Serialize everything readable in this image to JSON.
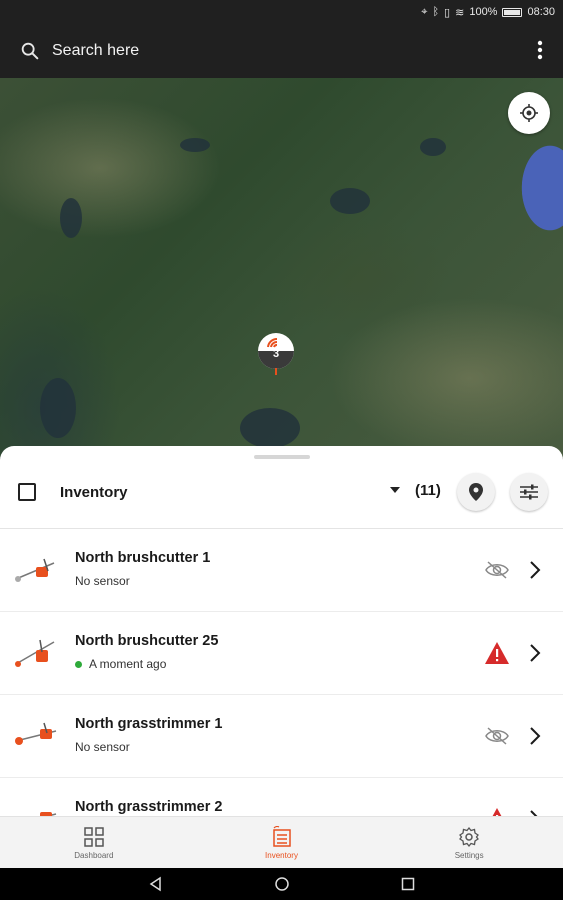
{
  "status_bar": {
    "battery": "100%",
    "time": "08:30",
    "icons": [
      "location-icon",
      "bluetooth-icon",
      "vibrate-icon",
      "wifi-icon",
      "battery-icon"
    ]
  },
  "app_bar": {
    "search_placeholder": "Search here",
    "icons": [
      "search-icon",
      "more-vert-icon"
    ]
  },
  "map": {
    "cluster_count": "3",
    "icons": [
      "my-location-icon",
      "cluster-marker-icon"
    ]
  },
  "sheet": {
    "title": "Inventory",
    "count": "(11)",
    "icons": [
      "map-pin-icon",
      "filter-sliders-icon",
      "dropdown-arrow-icon"
    ]
  },
  "items": [
    {
      "title": "North brushcutter 1",
      "subtitle": "No sensor",
      "status": "no-sensor",
      "status_icon": "eye-off-icon"
    },
    {
      "title": "North brushcutter 25",
      "subtitle": "A moment ago",
      "status": "online-alert",
      "status_icon": "warning-icon"
    },
    {
      "title": "North grasstrimmer 1",
      "subtitle": "No sensor",
      "status": "no-sensor",
      "status_icon": "eye-off-icon"
    },
    {
      "title": "North grasstrimmer 2",
      "subtitle": "",
      "status": "alert",
      "status_icon": "warning-icon"
    }
  ],
  "bottom_nav": [
    {
      "label": "Dashboard",
      "icon": "dashboard-grid-icon",
      "active": false
    },
    {
      "label": "Inventory",
      "icon": "inventory-list-icon",
      "active": true
    },
    {
      "label": "Settings",
      "icon": "gear-icon",
      "active": false
    }
  ],
  "colors": {
    "accent": "#e8501e",
    "alert": "#d62b2b",
    "online": "#2eaa3a",
    "app_bar": "#202020"
  }
}
